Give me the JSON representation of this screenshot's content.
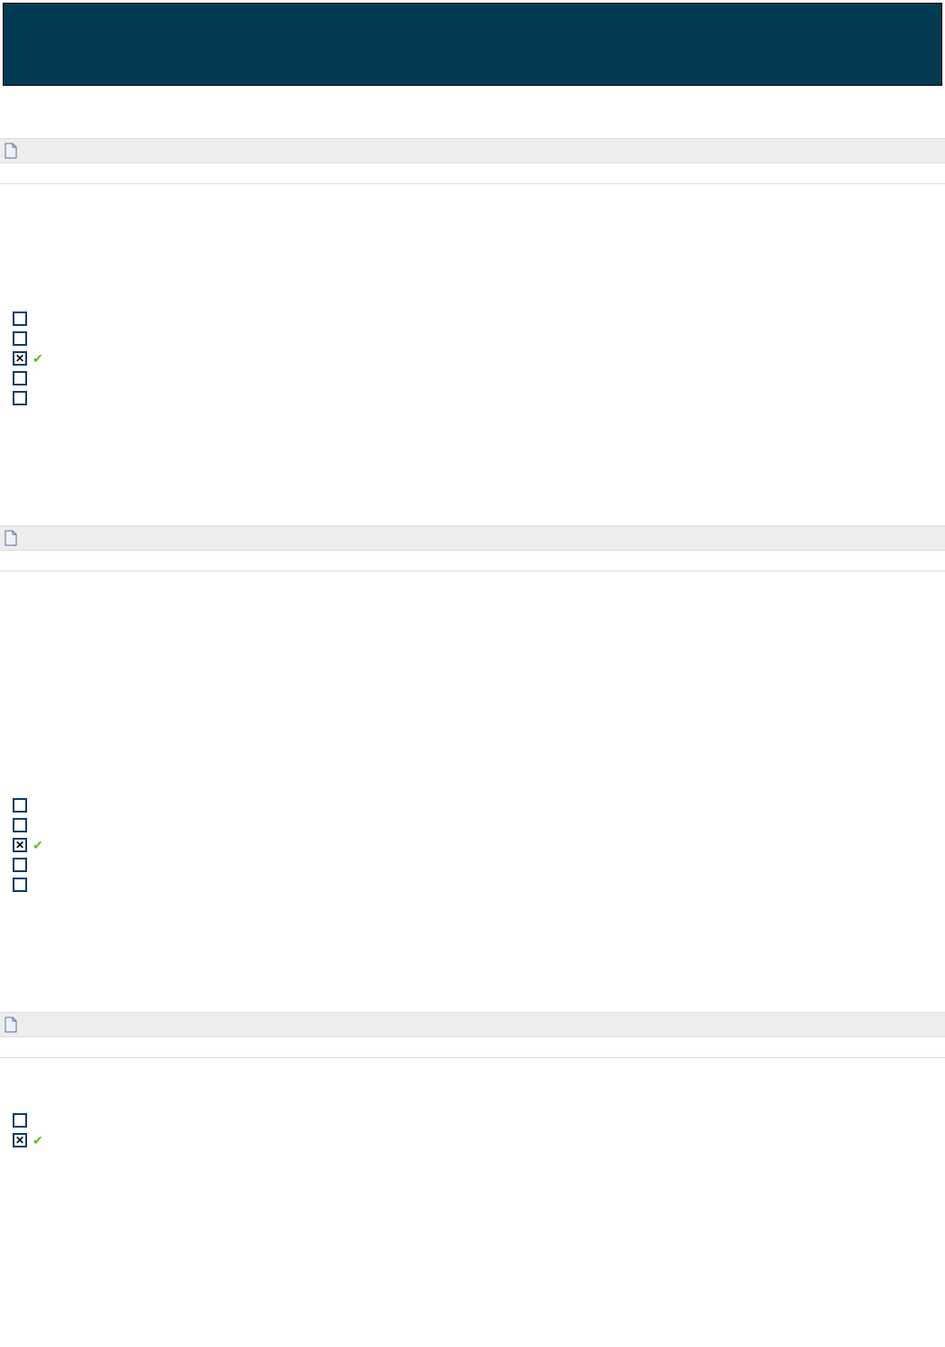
{
  "questions": [
    {
      "options": [
        {
          "checked": false
        },
        {
          "checked": false
        },
        {
          "checked": true
        },
        {
          "checked": false
        },
        {
          "checked": false
        }
      ]
    },
    {
      "options": [
        {
          "checked": false
        },
        {
          "checked": false
        },
        {
          "checked": true
        },
        {
          "checked": false
        },
        {
          "checked": false
        }
      ]
    },
    {
      "options": [
        {
          "checked": false
        },
        {
          "checked": true
        }
      ]
    }
  ]
}
